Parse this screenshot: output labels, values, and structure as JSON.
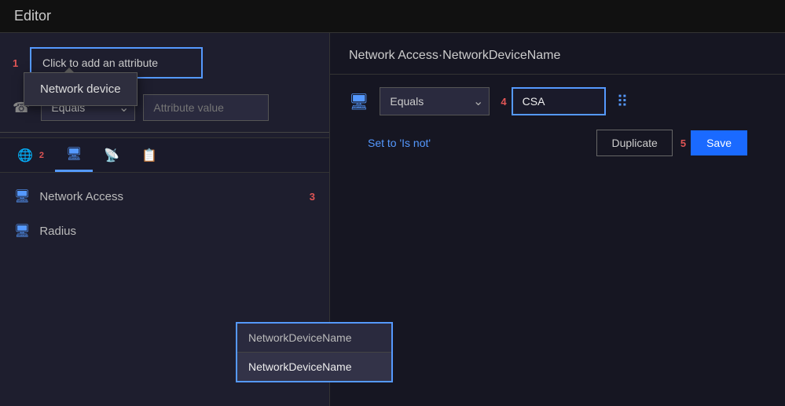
{
  "app": {
    "title": "Editor"
  },
  "left_panel": {
    "add_attribute_label": "Click to add an attribute",
    "add_attribute_step": "1",
    "equals_label": "Equals",
    "attribute_value_placeholder": "Attribute value",
    "tabs": [
      {
        "id": "globe",
        "icon": "🌐",
        "badge": "2",
        "active": false
      },
      {
        "id": "monitor",
        "icon": "🖥",
        "badge": "",
        "active": true
      },
      {
        "id": "network",
        "icon": "📡",
        "badge": "",
        "active": false
      },
      {
        "id": "doc",
        "icon": "📋",
        "badge": "",
        "active": false
      }
    ],
    "tooltip": {
      "text": "Network device"
    },
    "list_items": [
      {
        "id": "network-access",
        "icon": "🖥",
        "label": "Network Access",
        "step": "3"
      },
      {
        "id": "radius",
        "icon": "🖥",
        "label": "Radius",
        "step": ""
      }
    ],
    "dropdown": {
      "header": "NetworkDeviceName",
      "item": "NetworkDeviceName"
    }
  },
  "right_panel": {
    "header": "Network Access·NetworkDeviceName",
    "equals_label": "Equals",
    "step_4": "4",
    "csa_value": "CSA",
    "set_is_not_label": "Set to 'Is not'",
    "duplicate_label": "Duplicate",
    "step_5": "5",
    "save_label": "Save"
  }
}
